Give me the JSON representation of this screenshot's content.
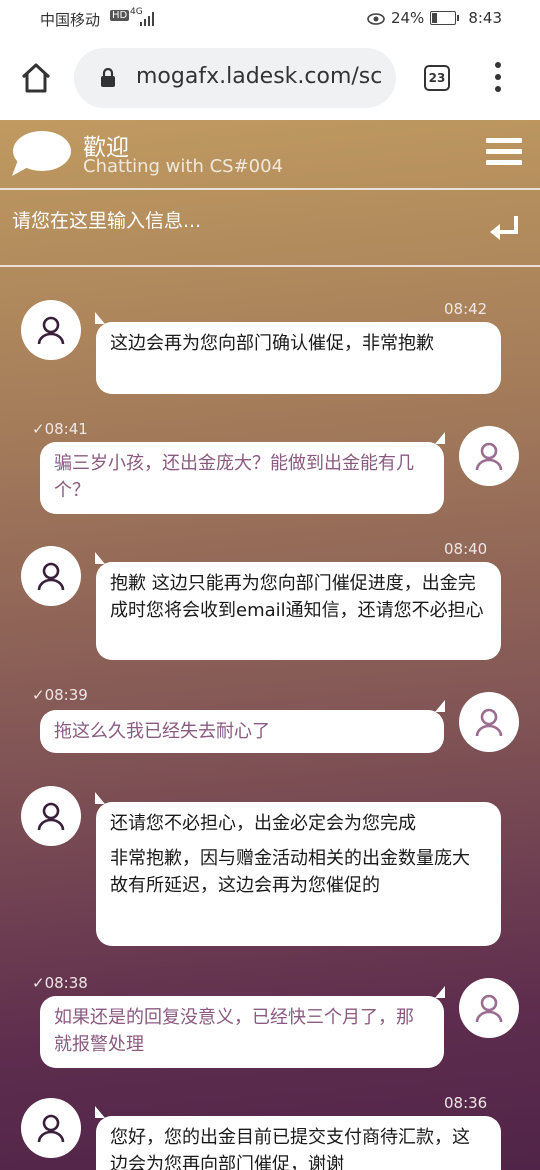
{
  "status_bar": {
    "carrier": "中国移动",
    "hd": "HD",
    "network": "4G",
    "battery": "24%",
    "battery_level": 0.24,
    "time": "8:43"
  },
  "browser": {
    "url": "mogafx.ladesk.com/sc",
    "tab_count": "23"
  },
  "chat_header": {
    "title": "歡迎",
    "subtitle": "Chatting with CS#004"
  },
  "input": {
    "placeholder": "请您在这里输入信息..."
  },
  "messages": [
    {
      "side": "left",
      "time": "08:42",
      "lines": [
        "这边会再为您向部门确认催促，非常抱歉"
      ]
    },
    {
      "side": "right",
      "time": "✓08:41",
      "lines": [
        "骗三岁小孩，还出金庞大？能做到出金能有几个？"
      ]
    },
    {
      "side": "left",
      "time": "08:40",
      "lines": [
        "抱歉 这边只能再为您向部门催促进度，出金完成时您将会收到email通知信，还请您不必担心"
      ]
    },
    {
      "side": "right",
      "time": "✓08:39",
      "lines": [
        "拖这么久我已经失去耐心了"
      ]
    },
    {
      "side": "left",
      "time": "",
      "lines": [
        "还请您不必担心，出金必定会为您完成",
        "非常抱歉，因与赠金活动相关的出金数量庞大故有所延迟，这边会再为您催促的"
      ]
    },
    {
      "side": "right",
      "time": "✓08:38",
      "lines": [
        "如果还是的回复没意义，已经快三个月了，那就报警处理"
      ]
    },
    {
      "side": "left",
      "time": "08:36",
      "lines": [
        "您好，您的出金目前已提交支付商待汇款，这边会为您再向部门催促，谢谢"
      ]
    }
  ]
}
